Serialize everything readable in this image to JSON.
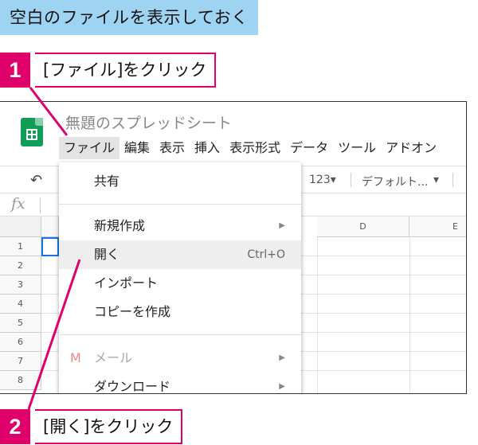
{
  "header": {
    "title": "空白のファイルを表示しておく"
  },
  "steps": [
    {
      "num": "1",
      "label": "[ファイル]をクリック"
    },
    {
      "num": "2",
      "label": "[開く]をクリック"
    }
  ],
  "app": {
    "doc_title": "無題のスプレッドシート",
    "menu": [
      "ファイル",
      "編集",
      "表示",
      "挿入",
      "表示形式",
      "データ",
      "ツール",
      "アドオン"
    ],
    "toolbar": {
      "format": "123▾",
      "font": "デフォルト...",
      "font_arrow": "▾"
    },
    "formula_label": "fx",
    "columns": [
      "D",
      "E"
    ],
    "rows": [
      "1",
      "2",
      "3",
      "4",
      "5",
      "6",
      "7",
      "8"
    ]
  },
  "file_menu": {
    "share": "共有",
    "new": "新規作成",
    "open": "開く",
    "open_shortcut": "Ctrl+O",
    "import": "インポート",
    "copy": "コピーを作成",
    "mail": "メール",
    "download": "ダウンロード"
  },
  "colors": {
    "accent": "#e0006b",
    "title_bg": "#9fd3f2",
    "sheets_green": "#0f9d58"
  },
  "icons": {
    "undo": "undo-icon",
    "logo": "sheets-logo-icon",
    "mail": "gmail-icon",
    "submenu": "triangle-right-icon"
  }
}
